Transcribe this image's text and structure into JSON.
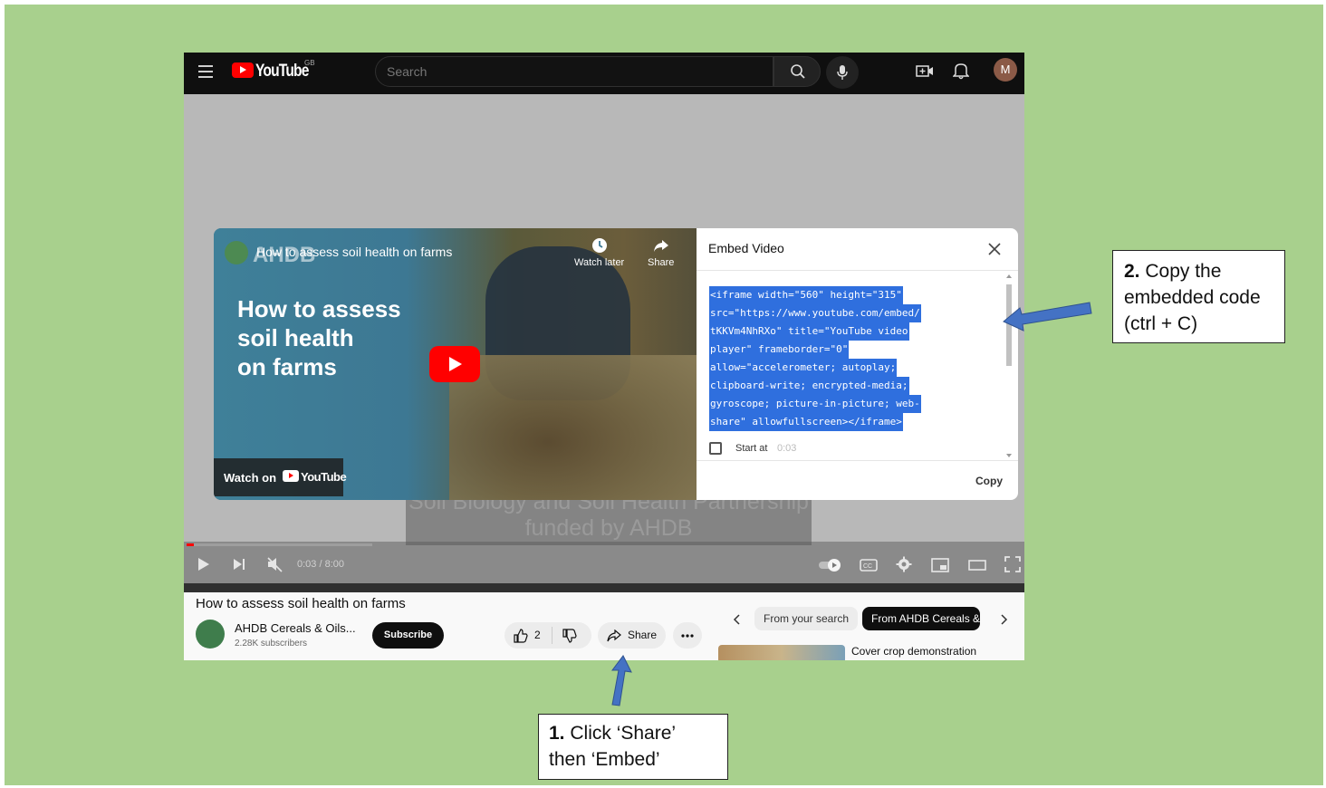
{
  "youtube": {
    "logo_text": "YouTube",
    "logo_country": "GB",
    "search_placeholder": "Search",
    "avatar_letter": "M"
  },
  "video_card": {
    "brand": "AHDB",
    "title": "How to assess soil health on farms",
    "big_title": "How to assess\nsoil health\non farms",
    "watch_later": "Watch later",
    "share": "Share",
    "watch_on": "Watch on",
    "watch_on_logo": "YouTube"
  },
  "embed_panel": {
    "title": "Embed Video",
    "code_lines": [
      "<iframe width=\"560\" height=\"315\"",
      "src=\"https://www.youtube.com/embed/",
      "tKKVm4NhRXo\" title=\"YouTube video",
      "player\" frameborder=\"0\"",
      "allow=\"accelerometer; autoplay;",
      "clipboard-write; encrypted-media;",
      "gyroscope; picture-in-picture; web-",
      "share\" allowfullscreen></iframe>"
    ],
    "start_at_label": "Start at",
    "start_at_time": "0:03",
    "copy_label": "Copy"
  },
  "player": {
    "subtitle_line1": "Soil Biology and Soil Health Partnership",
    "subtitle_line2": "funded by AHDB",
    "time": "0:03 / 8:00",
    "progress_fraction": 0.00625
  },
  "below_video": {
    "title": "How to assess soil health on farms",
    "channel_name": "AHDB Cereals & Oils...",
    "subscribers": "2.28K subscribers",
    "subscribe": "Subscribe",
    "likes": "2",
    "share": "Share",
    "chip_search": "From your search",
    "chip_channel": "From AHDB Cereals &",
    "rec_title": "Cover crop demonstration"
  },
  "callouts": {
    "step1_number": "1.",
    "step1_line1": "Click ‘Share’",
    "step1_line2": "then ‘Embed’",
    "step2_number": "2.",
    "step2_line1": "Copy the",
    "step2_line2": "embedded code",
    "step2_line3": "(ctrl + C)"
  },
  "colors": {
    "slide_bg": "#a8d08d",
    "arrow": "#4472c4",
    "yt_red": "#ff0000",
    "selection": "#2f6fde"
  }
}
